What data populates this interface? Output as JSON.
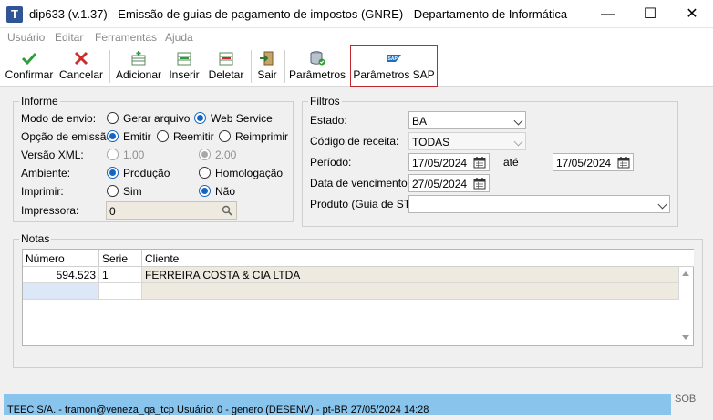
{
  "window": {
    "title": "dip633 (v.1.37) - Emissão de guias de pagamento de impostos (GNRE) - Departamento de Informática",
    "icon_letter": "T",
    "minimize": "—",
    "maximize": "☐",
    "close": "✕"
  },
  "menu": [
    "Usuário",
    "Editar",
    "Ferramentas",
    "Ajuda"
  ],
  "toolbar": {
    "confirmar": "Confirmar",
    "cancelar": "Cancelar",
    "adicionar": "Adicionar",
    "inserir": "Inserir",
    "deletar": "Deletar",
    "sair": "Sair",
    "parametros": "Parâmetros",
    "parametros_sap": "Parâmetros SAP",
    "sap_logo": "SAP"
  },
  "informe": {
    "title": "Informe",
    "modo_envio": {
      "label": "Modo de envio:",
      "opt1": "Gerar arquivo",
      "opt2": "Web Service",
      "selected": "Web Service"
    },
    "opcao_emissao": {
      "label": "Opção de emissão:",
      "opt1": "Emitir",
      "opt2": "Reemitir",
      "opt3": "Reimprimir",
      "selected": "Emitir"
    },
    "versao_xml": {
      "label": "Versão XML:",
      "opt1": "1.00",
      "opt2": "2.00",
      "selected": "2.00"
    },
    "ambiente": {
      "label": "Ambiente:",
      "opt1": "Produção",
      "opt2": "Homologação",
      "selected": "Produção"
    },
    "imprimir": {
      "label": "Imprimir:",
      "opt1": "Sim",
      "opt2": "Não",
      "selected": "Não"
    },
    "impressora": {
      "label": "Impressora:",
      "value": "0"
    }
  },
  "filtros": {
    "title": "Filtros",
    "estado": {
      "label": "Estado:",
      "value": "BA"
    },
    "codigo_receita": {
      "label": "Código de receita:",
      "value": "TODAS"
    },
    "periodo": {
      "label": "Período:",
      "from": "17/05/2024",
      "ate": "até",
      "to": "17/05/2024"
    },
    "vencimento": {
      "label": "Data de vencimento:",
      "value": "27/05/2024"
    },
    "produto": {
      "label": "Produto (Guia de ST):",
      "value": ""
    }
  },
  "notas": {
    "title": "Notas",
    "columns": [
      "Número",
      "Serie",
      "Cliente"
    ],
    "rows": [
      {
        "numero": "594.523",
        "serie": "1",
        "cliente": "FERREIRA COSTA & CIA LTDA"
      }
    ]
  },
  "status": {
    "text": "TEEC S/A. - tramon@veneza_qa_tcp    Usuário: 0 - genero (DESENV) - pt-BR    27/05/2024 14:28",
    "right": "SOB"
  },
  "colors": {
    "accent": "#1565c0",
    "status_bg": "#88c4ec",
    "sap_highlight": "#c0282f"
  }
}
